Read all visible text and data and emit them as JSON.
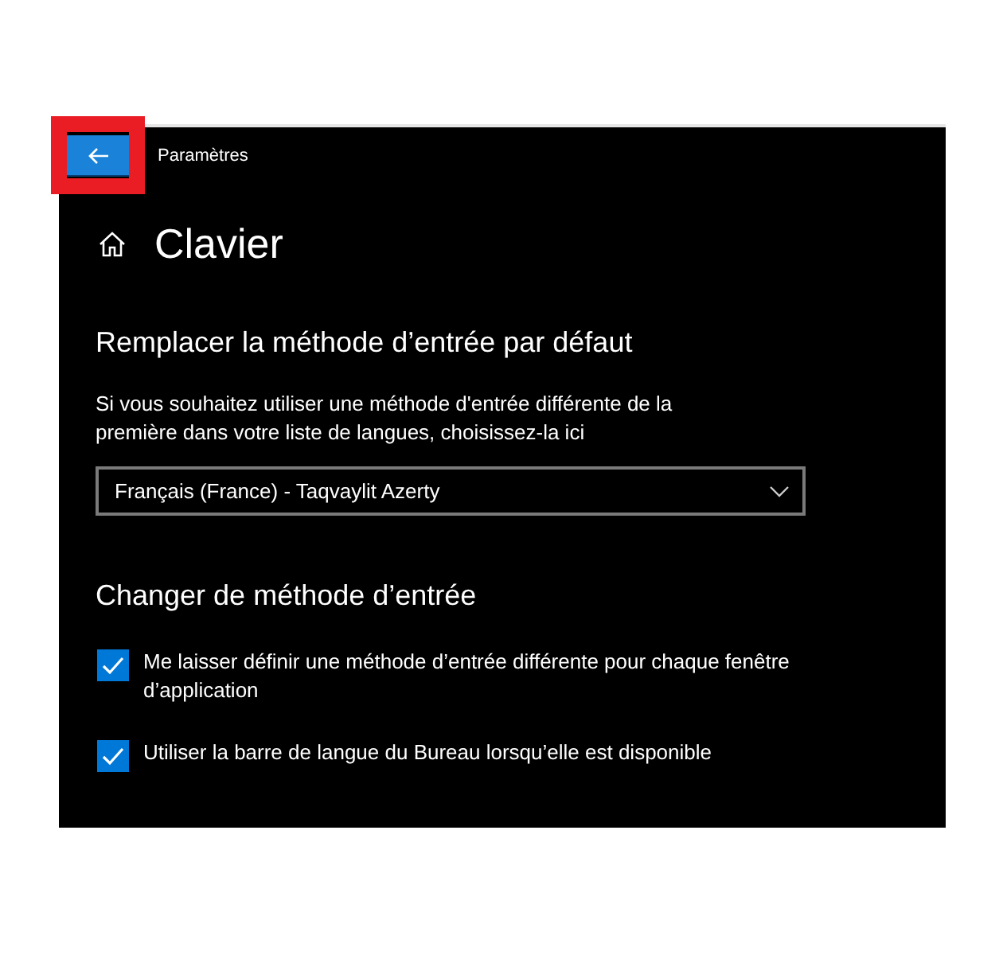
{
  "window": {
    "title": "Paramètres",
    "highlight_back": true
  },
  "page": {
    "title": "Clavier"
  },
  "sections": [
    {
      "heading": "Remplacer la méthode d’entrée par défaut",
      "description": "Si vous souhaitez utiliser une méthode d'entrée différente de la première dans votre liste de langues, choisissez-la ici",
      "dropdown": {
        "value": "Français (France) - Taqvaylit Azerty"
      }
    },
    {
      "heading": "Changer de méthode d’entrée",
      "options": [
        {
          "label": "Me laisser définir une méthode d’entrée différente pour chaque fenêtre d’application",
          "checked": true
        },
        {
          "label": "Utiliser la barre de langue du Bureau lorsqu’elle est disponible",
          "checked": true
        }
      ]
    }
  ]
}
